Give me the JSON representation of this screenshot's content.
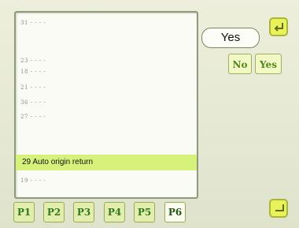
{
  "param_list": {
    "rows": [
      "31 - - - -",
      "23 - - - -",
      "18 - - - -",
      "21 - - - -",
      "36 - - - -",
      "27 - - - -"
    ],
    "selected_row": "29 Auto origin return",
    "last_row": "19 - - - -"
  },
  "value_display": "Yes",
  "choices": {
    "no_label": "No",
    "yes_label": "Yes"
  },
  "page_tabs": [
    "P1",
    "P2",
    "P3",
    "P4",
    "P5",
    "P6"
  ],
  "active_tab": "P6",
  "icons": {
    "top_right": "return-arrow-icon",
    "bottom_right": "enter-icon"
  },
  "colors": {
    "selection": "#d7f27a",
    "accent_text": "#2f7a1f",
    "button": "#e9f25a"
  }
}
